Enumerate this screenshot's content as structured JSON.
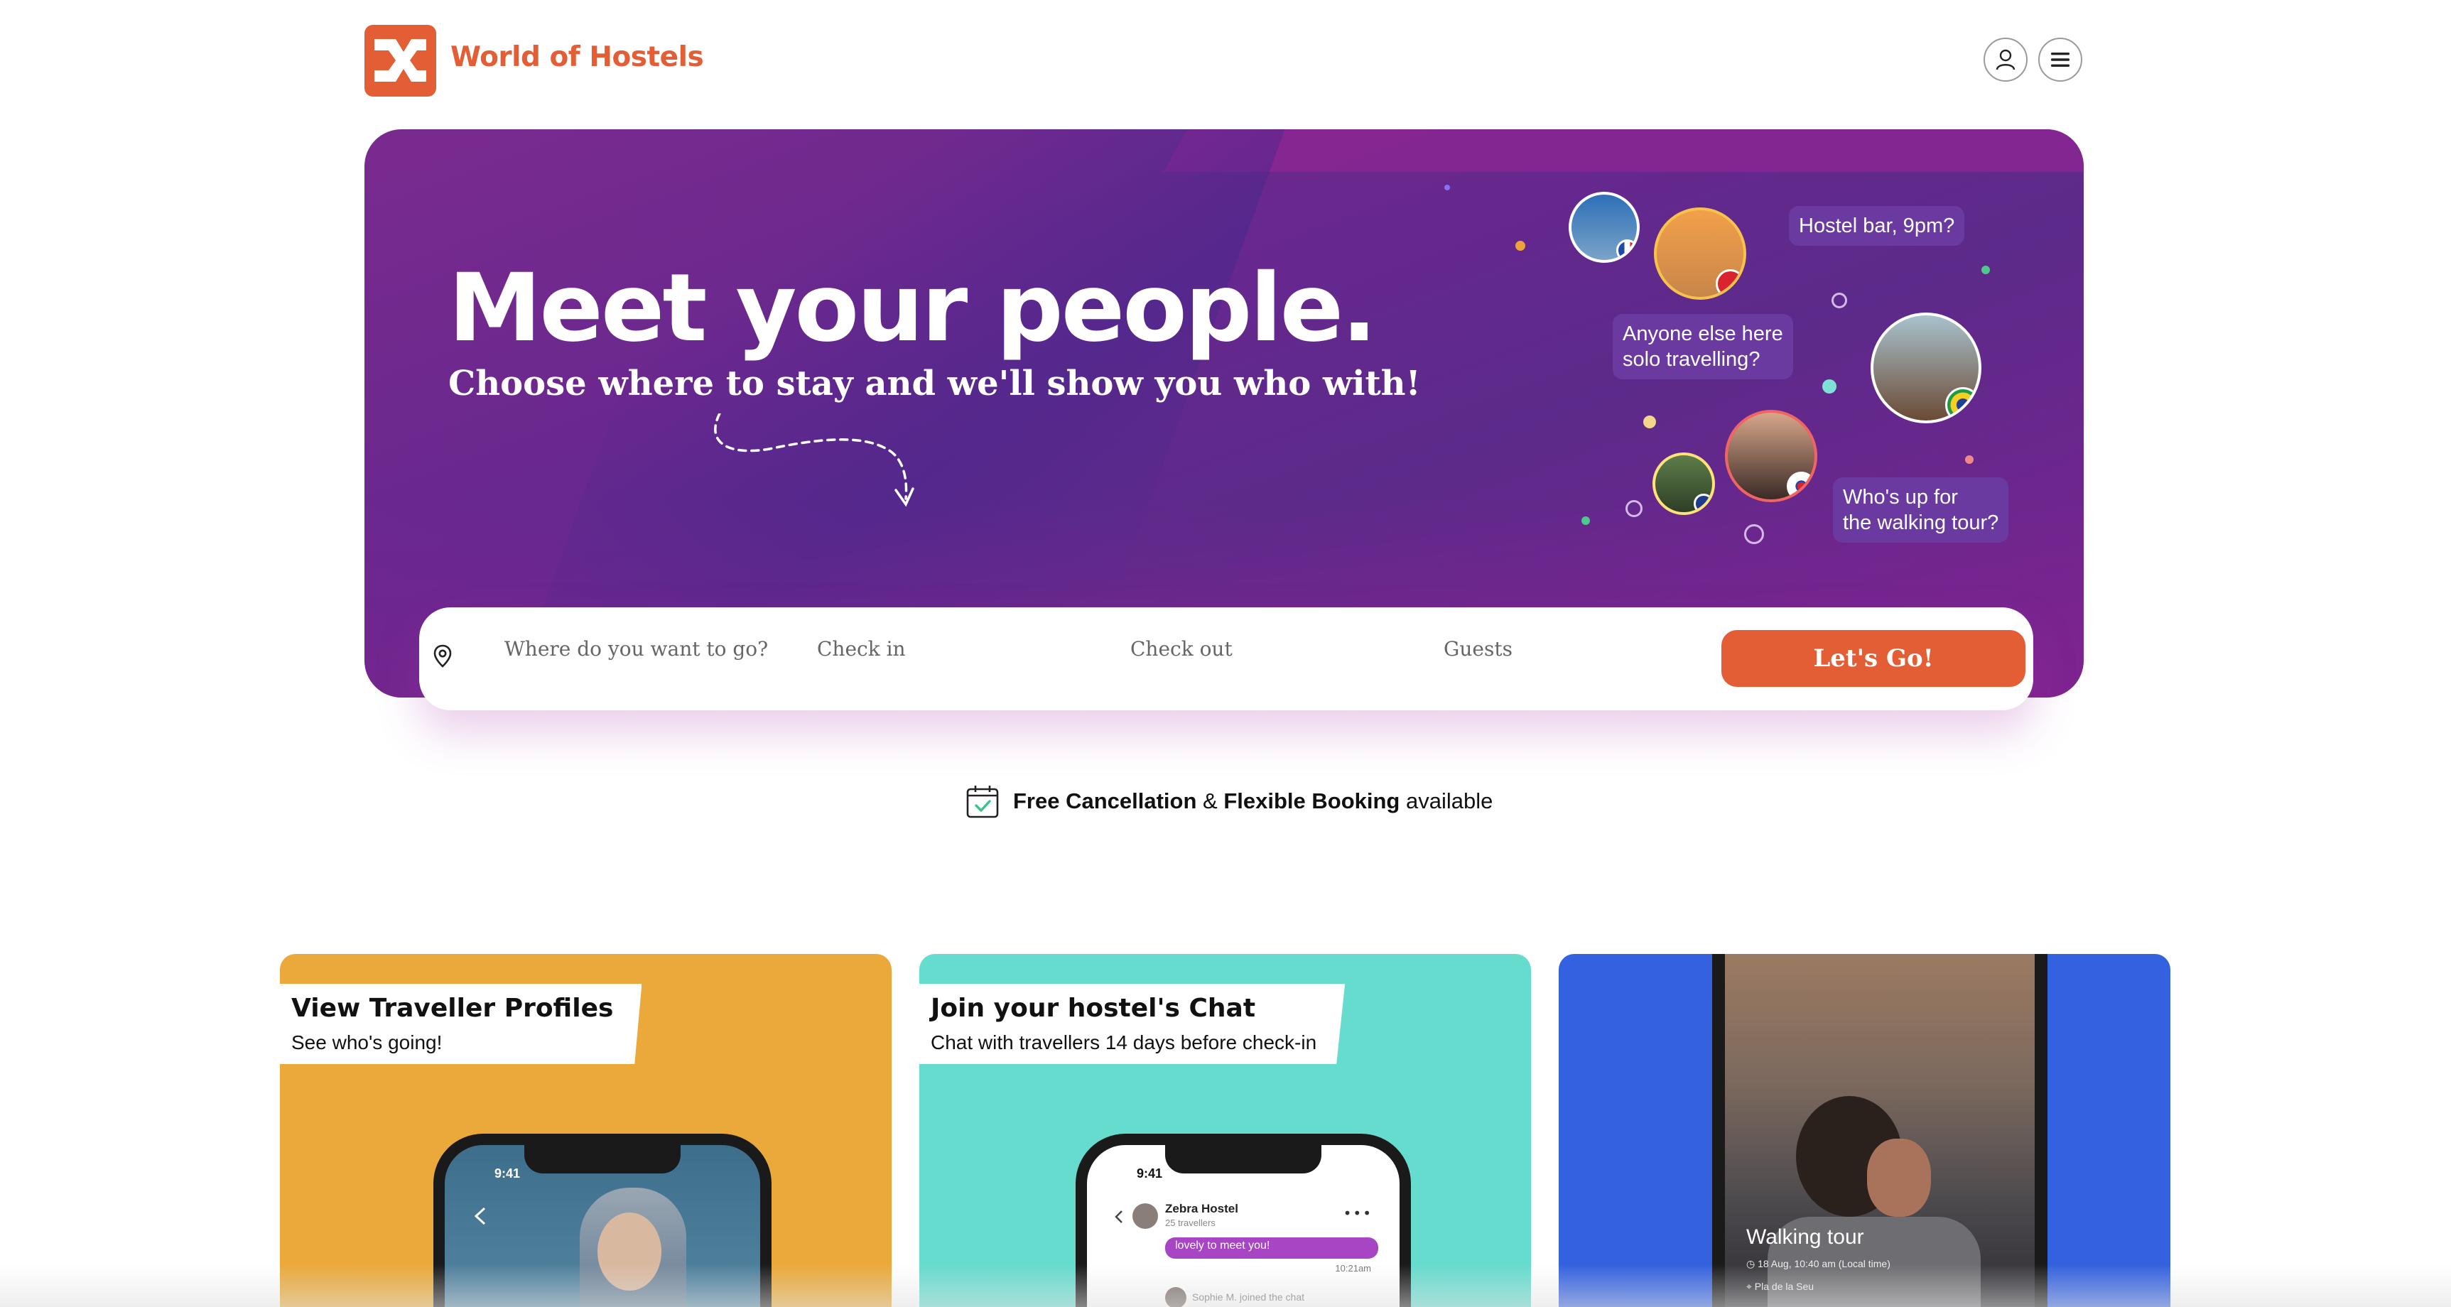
{
  "brand": {
    "name": "World of Hostels",
    "accent": "#e35d35"
  },
  "header": {
    "account_icon": "user-icon",
    "menu_icon": "hamburger-menu-icon"
  },
  "hero": {
    "title": "Meet your people.",
    "subtitle": "Choose where to stay and we'll show you who with!",
    "bubbles": [
      "Hostel bar, 9pm?",
      "Anyone else here",
      "solo travelling?",
      "Who's up for",
      "the walking tour?"
    ]
  },
  "search": {
    "destination_placeholder": "Where do you want to go?",
    "checkin_placeholder": "Check in",
    "checkout_placeholder": "Check out",
    "guests_placeholder": "Guests",
    "submit_label": "Let's Go!"
  },
  "cancellation": {
    "bold1": "Free Cancellation",
    "amp": " & ",
    "bold2": "Flexible Booking",
    "rest": " available"
  },
  "cards": [
    {
      "title": "View Traveller Profiles",
      "subtitle": "See who's going!",
      "bg": "#eaa93a",
      "phone_time": "9:41"
    },
    {
      "title": "Join your hostel's Chat",
      "subtitle": "Chat with travellers 14 days before check-in",
      "bg": "#66dcce",
      "phone_time": "9:41",
      "chat": {
        "hostel": "Zebra Hostel",
        "count": "25 travellers",
        "message": "lovely to meet you!",
        "time": "10:21am",
        "joined": "Sophie M. joined the chat"
      }
    },
    {
      "bg": "#3461df",
      "event": {
        "title": "Walking tour",
        "when": "18 Aug, 10:40 am (Local time)",
        "where": "Pla de la Seu"
      }
    }
  ]
}
